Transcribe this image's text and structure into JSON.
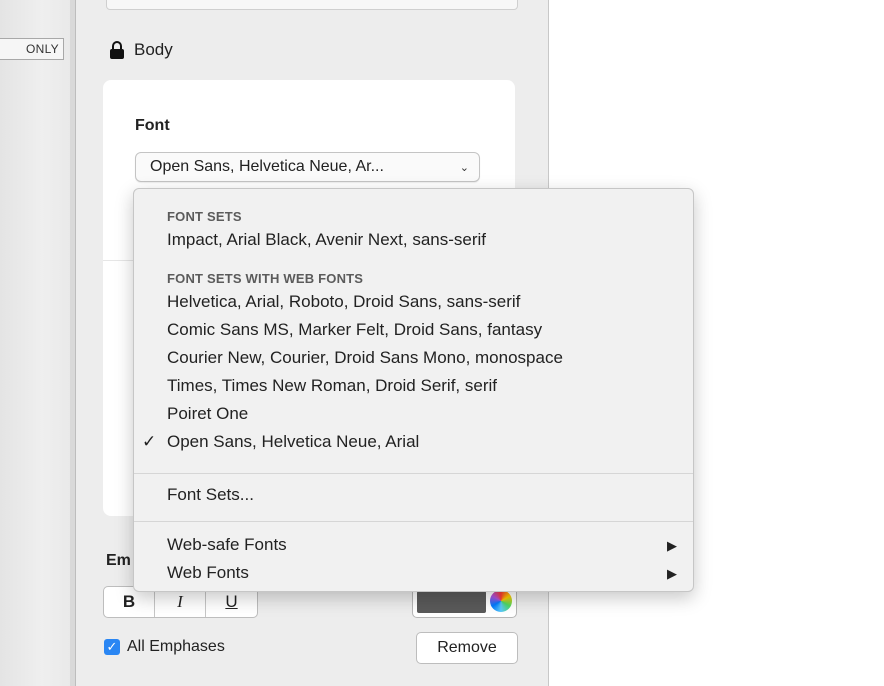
{
  "left_tab": {
    "label": "ONLY"
  },
  "panel": {
    "section_title": "Body",
    "font_label": "Font",
    "font_selected": "Open Sans, Helvetica Neue, Ar...",
    "emphasis_label": "Em",
    "style_buttons": {
      "bold": "B",
      "italic": "I",
      "underline": "U"
    },
    "emphasis_color": "#5a5a5a",
    "all_emphases_label": "All Emphases",
    "all_emphases_checked": true,
    "remove_label": "Remove"
  },
  "menu": {
    "section1_title": "FONT SETS",
    "section1_items": [
      "Impact, Arial Black, Avenir Next, sans-serif"
    ],
    "section2_title": "FONT SETS WITH WEB FONTS",
    "section2_items": [
      "Helvetica, Arial, Roboto, Droid Sans, sans-serif",
      "Comic Sans MS, Marker Felt, Droid Sans, fantasy",
      "Courier New, Courier, Droid Sans Mono, monospace",
      "Times, Times New Roman, Droid Serif, serif",
      "Poiret One",
      "Open Sans, Helvetica Neue, Arial"
    ],
    "checked_item": "Open Sans, Helvetica Neue, Arial",
    "check_glyph": "✓",
    "font_sets_item": "Font Sets...",
    "submenus": [
      "Web-safe Fonts",
      "Web Fonts"
    ],
    "submenu_arrow": "▶"
  },
  "colors": {
    "accent": "#2a86f3"
  }
}
